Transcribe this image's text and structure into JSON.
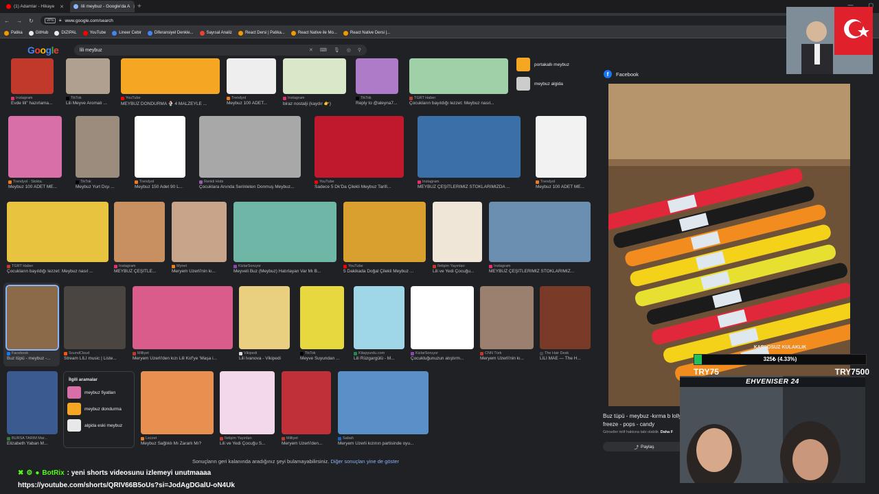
{
  "browser": {
    "tabs": [
      {
        "title": "(1) Adamlar - Hikaye",
        "active": false,
        "icon_color": "#ff0000"
      },
      {
        "title": "lili meybuz - Google'da A",
        "active": true,
        "icon_color": "#8ab4f8"
      }
    ],
    "url": "www.google.com/search",
    "vpn_label": "VPN",
    "bookmarks": [
      {
        "label": "Patika",
        "color": "#f29900"
      },
      {
        "label": "GitHub",
        "color": "#e8eaed"
      },
      {
        "label": "DIZIPAL",
        "color": "#e8eaed"
      },
      {
        "label": "YouTube",
        "color": "#ff0000"
      },
      {
        "label": "Lineer Cebir",
        "color": "#4285f4"
      },
      {
        "label": "Diferansiyel Denkle...",
        "color": "#4285f4"
      },
      {
        "label": "Sayısal Analiz",
        "color": "#ea4335"
      },
      {
        "label": "React Dersi | Patika...",
        "color": "#f29900"
      },
      {
        "label": "React Native ile Mo...",
        "color": "#f29900"
      },
      {
        "label": "React Native Dersi |...",
        "color": "#f29900"
      }
    ]
  },
  "google": {
    "logo": "Google",
    "query": "lili meybuz"
  },
  "images": [
    {
      "source": "Instagram",
      "title": "Evde lili\" hazırlama...",
      "color": "#c0392b",
      "src_color": "#e1306c"
    },
    {
      "source": "TikTok",
      "title": "Lili Meyve Aromalı ...",
      "color": "#b0a090",
      "src_color": "#000000"
    },
    {
      "source": "YouTube",
      "title": "MEYBUZ DONDURMA 🍨 4 MALZEYLE ...",
      "color": "#f5a623",
      "src_color": "#ff0000"
    },
    {
      "source": "Trendyol",
      "title": "Meybuz 100 ADET...",
      "color": "#eeeeee",
      "src_color": "#f27a1a"
    },
    {
      "source": "Instagram",
      "title": "biraz nostalji (kaydır 👉)",
      "color": "#d8e8c8",
      "src_color": "#e1306c"
    },
    {
      "source": "TikTok",
      "title": "Reply to @aleyna7...",
      "color": "#ad7bc7",
      "src_color": "#000000"
    },
    {
      "source": "TGRT Haber",
      "title": "Çocukların bayıldığı lezzet: Meybuz nasıl...",
      "color": "#9fd0a8",
      "src_color": "#c0392b"
    },
    {
      "source": "Trendyol · Stokta",
      "title": "Meybuz 100 ADET ME...",
      "color": "#d96fa8",
      "src_color": "#f27a1a"
    },
    {
      "source": "TikTok",
      "title": "Meybuz Yurt Dışı ...",
      "color": "#9b8c7e",
      "src_color": "#000000"
    },
    {
      "source": "Trendyol",
      "title": "Meybuz 150 Adet 90 L...",
      "color": "#ffffff",
      "src_color": "#f27a1a"
    },
    {
      "source": "Renkli Hobi",
      "title": "Çocuklara Anında Serinleten Donmuş Meybuz...",
      "color": "#a8a8a8",
      "src_color": "#9b59b6"
    },
    {
      "source": "YouTube",
      "title": "Sadece 5 Dk'Da Çilekli Meybuz Tarifi...",
      "color": "#c0182c",
      "src_color": "#ff0000"
    },
    {
      "source": "Instagram",
      "title": "MEYBUZ ÇEŞİTLERİMİZ STOKLARIMIZDA ...",
      "color": "#3a6fa8",
      "src_color": "#e1306c"
    },
    {
      "source": "Trendyol",
      "title": "Meybuz 100 ADET ME...",
      "color": "#f2f2f2",
      "src_color": "#f27a1a"
    },
    {
      "source": "TGRT Haber",
      "title": "Çocukların bayıldığı lezzet: Meybuz nasıl ...",
      "color": "#e8c340",
      "src_color": "#c0392b"
    },
    {
      "source": "Instagram",
      "title": "MEYBUZ ÇEŞİTLE...",
      "color": "#c89060",
      "src_color": "#e1306c"
    },
    {
      "source": "Mynet",
      "title": "Meryem Uzerli'nin kı...",
      "color": "#c8a58a",
      "src_color": "#e67e22"
    },
    {
      "source": "KizlarSoruyor",
      "title": "Meyveli Buz (Meybuz) Hatırlayan Var Mı B...",
      "color": "#6fb6a6",
      "src_color": "#8e44ad"
    },
    {
      "source": "YouTube",
      "title": "5 Dakikada Doğal Çilekli Meybuz ...",
      "color": "#d9a030",
      "src_color": "#ff0000"
    },
    {
      "source": "İletişim Yayınları",
      "title": "Lili ve Yedi Çocuğu...",
      "color": "#f0e6d8",
      "src_color": "#c0392b"
    },
    {
      "source": "Instagram",
      "title": "MEYBUZ ÇEŞİTLERİMİZ STOKLARIMIZ...",
      "color": "#6a8fb0",
      "src_color": "#e1306c"
    },
    {
      "source": "Facebook",
      "title": "Buz tüpü - meybuz -...",
      "color": "#8b6a4a",
      "src_color": "#1877f2"
    },
    {
      "source": "SoundCloud",
      "title": "Stream LILI music | Liste...",
      "color": "#4a4540",
      "src_color": "#ff5500"
    },
    {
      "source": "Milliyet",
      "title": "Meryem Uzerli'den kızı Lili Kof'ye 'Maşa i...",
      "color": "#d95c8a",
      "src_color": "#c0392b"
    },
    {
      "source": "Vikipedi",
      "title": "Lili İvanova - Vikipedi",
      "color": "#e8d080",
      "src_color": "#dddddd"
    },
    {
      "source": "TikTok",
      "title": "Meyve Suyundan ...",
      "color": "#e8d840",
      "src_color": "#000000"
    },
    {
      "source": "Kitapyurdu.com",
      "title": "Lili Rüzgargülü - M...",
      "color": "#9fd6e8",
      "src_color": "#1f8a4c"
    },
    {
      "source": "KizlarSoruyor",
      "title": "Çocukluğunuzun atıştırm...",
      "color": "#ffffff",
      "src_color": "#8e44ad"
    },
    {
      "source": "CNN Türk",
      "title": "Meryem Uzerli'nin kı...",
      "color": "#9b8070",
      "src_color": "#c0392b"
    },
    {
      "source": "The Hair Desk",
      "title": "LILI MAE — The H...",
      "color": "#7a3a28",
      "src_color": "#444444"
    },
    {
      "source": "BURSA TARIM Mar...",
      "title": "Elizabeth Yaban M...",
      "color": "#3a5a90",
      "src_color": "#2e7d32"
    },
    {
      "source": "Lezzet",
      "title": "Meybuz Sağlıklı Mı Zararlı Mı?",
      "color": "#e89050",
      "src_color": "#e67e22"
    },
    {
      "source": "İletişim Yayınları",
      "title": "Lili ve Yedi Çocuğu S...",
      "color": "#f2d8e8",
      "src_color": "#c0392b"
    },
    {
      "source": "Milliyet",
      "title": "Meryem Uzerli'den...",
      "color": "#c03038",
      "src_color": "#c0392b"
    },
    {
      "source": "Sabah",
      "title": "Meryem Uzerli kızının partisinde oyu...",
      "color": "#5a90c8",
      "src_color": "#1565c0"
    }
  ],
  "side_chips": [
    {
      "label": "portakallı meybuz",
      "bold": "portakallı",
      "color": "#f5a623"
    },
    {
      "label": "meybuz algida",
      "bold": "algida",
      "color": "#cccccc"
    }
  ],
  "related": {
    "title": "İlgili aramalar",
    "items": [
      {
        "label": "meybuz fiyatları",
        "color": "#d96fa8"
      },
      {
        "label": "meybuz dondurma",
        "color": "#f5a623"
      },
      {
        "label": "algida eski meybuz",
        "color": "#e8e8e8"
      }
    ]
  },
  "footer": {
    "message": "Sonuçların geri kalanında aradığınız şeyi bulamayabilirsiniz.",
    "link": "Diğer sonuçları yine de göster"
  },
  "preview": {
    "source": "Facebook",
    "caption": "Buz tüpü - meybuz -kırma b lolly - freeze - pops - candy",
    "copyright": "Görseller telif hakkına tabi olabilir.",
    "more": "Daha F",
    "share": "Paylaş"
  },
  "donation": {
    "title": "KABLOSUZ KULAKLIK",
    "value_label": "325₺ (4.33%)",
    "progress": 0.0433,
    "min": "TRY75",
    "max": "TRY7500"
  },
  "webcam": {
    "name": "EHVENISER 24"
  },
  "chat": {
    "user": "BotRix",
    "message": ": yeni shorts videosunu izlemeyi unutmaaaa",
    "url": "https://youtube.com/shorts/QRIV66B5oUs?si=JodAgDGalU-oN4Uk"
  }
}
